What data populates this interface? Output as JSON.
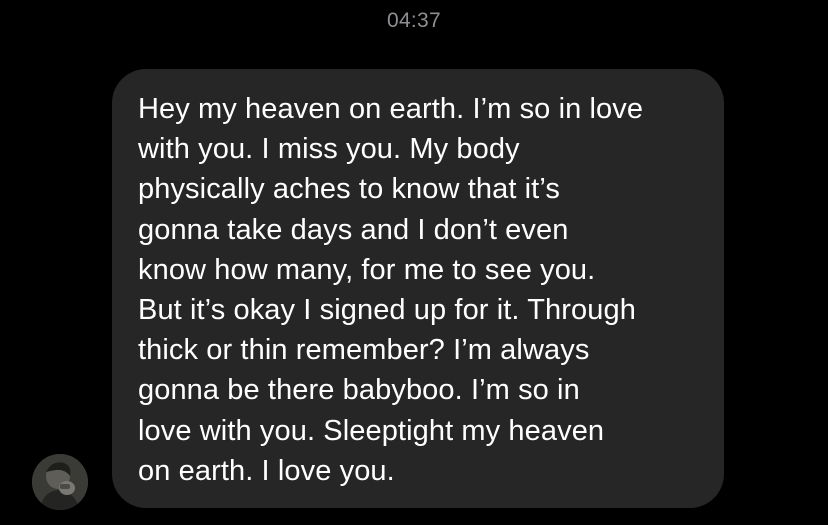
{
  "conversation": {
    "timestamp": "04:37",
    "messages": [
      {
        "sender": "contact",
        "avatar_icon": "user-avatar",
        "text": "Hey my heaven on earth. I’m so in love\nwith you. I miss you. My body\nphysically aches to know that it’s\ngonna take days and I don’t even\nknow how many, for me to see you.\nBut it’s okay I signed up for it. Through\nthick or thin remember? I’m always\ngonna be there babyboo. I’m so in\nlove with you. Sleeptight my heaven\non earth. I love you."
      }
    ]
  },
  "colors": {
    "background": "#000000",
    "bubble": "#262626",
    "text": "#ffffff",
    "timestamp": "#8e8e93"
  }
}
